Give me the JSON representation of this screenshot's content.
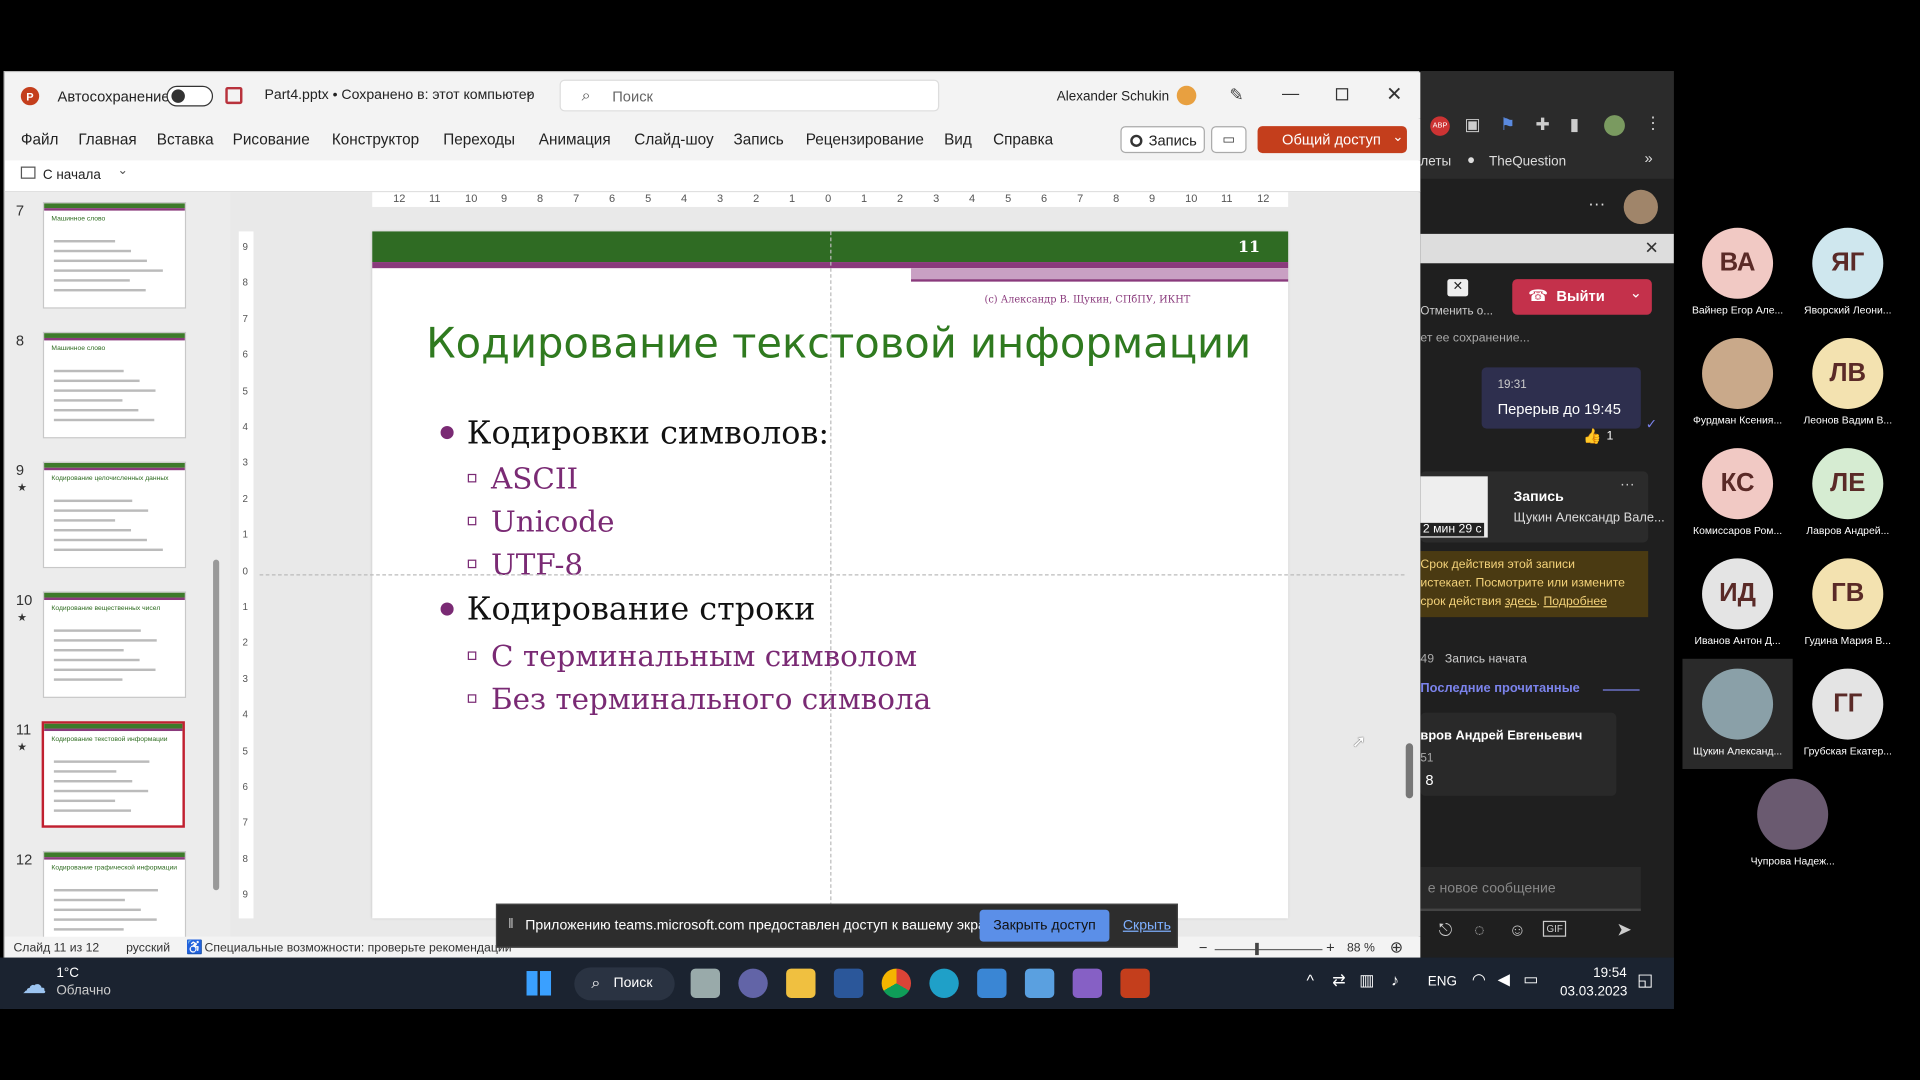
{
  "ppt": {
    "autosave_label": "Автосохранение",
    "filename": "Part4.pptx • Сохранено в: этот компьютер",
    "search_placeholder": "Поиск",
    "user": "Alexander Schukin",
    "menu": [
      "Файл",
      "Главная",
      "Вставка",
      "Рисование",
      "Конструктор",
      "Переходы",
      "Анимация",
      "Слайд-шоу",
      "Запись",
      "Рецензирование",
      "Вид",
      "Справка"
    ],
    "record_btn": "Запись",
    "share_btn": "Общий доступ",
    "from_start": "С начала"
  },
  "thumbnails": [
    {
      "num": "7",
      "star": "",
      "title": "Машинное слово"
    },
    {
      "num": "8",
      "star": "",
      "title": "Машинное слово"
    },
    {
      "num": "9",
      "star": "★",
      "title": "Кодирование целочисленных данных"
    },
    {
      "num": "10",
      "star": "★",
      "title": "Кодирование вещественных чисел"
    },
    {
      "num": "11",
      "star": "★",
      "title": "Кодирование текстовой информации"
    },
    {
      "num": "12",
      "star": "",
      "title": "Кодирование графической информации"
    }
  ],
  "ruler": {
    "h": [
      "12",
      "11",
      "10",
      "9",
      "8",
      "7",
      "6",
      "5",
      "4",
      "3",
      "2",
      "1",
      "0",
      "1",
      "2",
      "3",
      "4",
      "5",
      "6",
      "7",
      "8",
      "9",
      "10",
      "11",
      "12"
    ],
    "v": [
      "9",
      "8",
      "7",
      "6",
      "5",
      "4",
      "3",
      "2",
      "1",
      "0",
      "1",
      "2",
      "3",
      "4",
      "5",
      "6",
      "7",
      "8",
      "9"
    ]
  },
  "slide": {
    "number": "11",
    "copyright": "(c) Александр В. Щукин, СПбПУ, ИКНТ",
    "title": "Кодирование текстовой информации",
    "bullet1": "Кодировки символов:",
    "sub1": [
      "ASCII",
      "Unicode",
      "UTF-8"
    ],
    "bullet2": "Кодирование строки",
    "sub2": [
      "С терминальным символом",
      "Без терминального символа"
    ]
  },
  "share_bar": {
    "message": "Приложению teams.microsoft.com предоставлен доступ к вашему экрану.",
    "stop": "Закрыть доступ",
    "hide": "Скрыть"
  },
  "status": {
    "slide_of": "Слайд 11 из 12",
    "lang": "русский",
    "accessibility": "Специальные возможности: проверьте рекомендации",
    "zoom": "88 %"
  },
  "teams": {
    "bookmark": "TheQuestion",
    "bookmark_prefix": "леты",
    "cancel_label": "Отменить о...",
    "leave": "Выйти",
    "save_hint": "ет ее сохранение...",
    "msg_time": "19:31",
    "msg_text": "Перерыв до 19:45",
    "reaction_count": "1",
    "rec_title": "Запись",
    "rec_user": "Щукин Александр Вале...",
    "rec_time": "2 мин 29 с",
    "warn_line1": "Срок действия этой записи",
    "warn_line2": "истекает. Посмотрите или измените",
    "warn_line3": "срок действия",
    "warn_link1": "здесь",
    "warn_link2": "Подробнее",
    "rec_started_time": "49",
    "rec_started": "Запись начата",
    "last_read": "Последние прочитанные",
    "user_name": "вров Андрей Евгеньевич",
    "user_time": "51",
    "user_msg": "8",
    "compose_placeholder": "е новое сообщение"
  },
  "participants": [
    {
      "initials": "ВА",
      "name": "Вайнер Егор Але...",
      "color": "#f1c9c4"
    },
    {
      "initials": "ЯГ",
      "name": "Яворский Леони...",
      "color": "#cfe7ee"
    },
    {
      "initials": "",
      "name": "Фурдман Ксения...",
      "color": "#c9a98a"
    },
    {
      "initials": "ЛВ",
      "name": "Леонов Вадим В...",
      "color": "#f3e2b0"
    },
    {
      "initials": "КС",
      "name": "Комиссаров Ром...",
      "color": "#f1c9c4"
    },
    {
      "initials": "ЛЕ",
      "name": "Лавров Андрей...",
      "color": "#d6ecd2"
    },
    {
      "initials": "ИД",
      "name": "Иванов Антон Д...",
      "color": "#e4e4e4"
    },
    {
      "initials": "ГВ",
      "name": "Гудина Мария В...",
      "color": "#f3e2b0"
    },
    {
      "initials": "",
      "name": "Щукин Александ...",
      "color": "#8aa0a8"
    },
    {
      "initials": "ГГ",
      "name": "Грубская Екатер...",
      "color": "#e4e4e4"
    },
    {
      "initials": "",
      "name": "Чупрова Надеж...",
      "color": "#6a5a70"
    }
  ],
  "taskbar": {
    "temp": "1°C",
    "weather": "Облачно",
    "search": "Поиск",
    "lang": "ENG",
    "time": "19:54",
    "date": "03.03.2023"
  }
}
